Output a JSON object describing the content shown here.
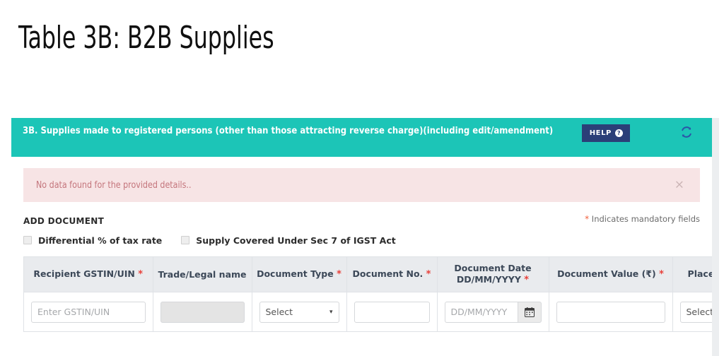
{
  "slide": {
    "title": "Table 3B: B2B Supplies"
  },
  "panel": {
    "header": {
      "title": "3B. Supplies made to registered persons (other than those attracting reverse charge)(including edit/amendment)",
      "help_label": "HELP",
      "help_icon_char": "?",
      "help_icon_name": "question-circle-icon",
      "refresh_icon_name": "refresh-icon",
      "background_color": "#1cc5b7",
      "help_button_color": "#2b3f78"
    },
    "alert": {
      "message": "No data found for the provided details..",
      "close_label": "×",
      "background_color": "#f7e4e5",
      "text_color": "#c4757c"
    },
    "add_document": {
      "title": "ADD DOCUMENT",
      "mandatory_note_star": "*",
      "mandatory_note_text": "Indicates mandatory fields",
      "checkboxes": [
        {
          "label": "Differential % of tax rate",
          "checked": false
        },
        {
          "label": "Supply Covered Under Sec 7 of IGST Act",
          "checked": false
        }
      ]
    },
    "table": {
      "columns": [
        {
          "label": "Recipient GSTIN/UIN",
          "required": true,
          "line2": ""
        },
        {
          "label": "Trade/Legal name",
          "required": false,
          "line2": ""
        },
        {
          "label": "Document Type",
          "required": true,
          "line2": ""
        },
        {
          "label": "Document No.",
          "required": true,
          "line2": ""
        },
        {
          "label": "Document Date",
          "required": true,
          "line2": "DD/MM/YYYY"
        },
        {
          "label": "Document Value (₹)",
          "required": true,
          "line2": ""
        },
        {
          "label": "Place of Supply",
          "required": true,
          "line2": ""
        }
      ],
      "row": {
        "gstin_placeholder": "Enter GSTIN/UIN",
        "gstin_value": "",
        "trade_name_value": "",
        "doc_type_value": "Select",
        "doc_no_value": "",
        "doc_date_placeholder": "DD/MM/YYYY",
        "doc_date_value": "",
        "calendar_icon_name": "calendar-icon",
        "doc_value_value": "",
        "place_of_supply_value": "Select",
        "caret_char": "▾"
      }
    }
  }
}
